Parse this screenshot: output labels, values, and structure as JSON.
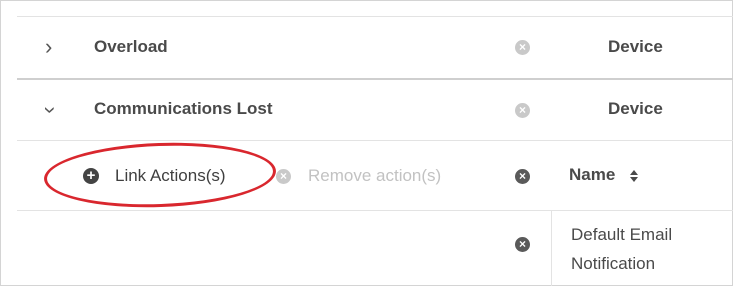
{
  "rows": [
    {
      "expand_icon": "chevron-right-icon",
      "label": "Overload",
      "type": "Device"
    },
    {
      "expand_icon": "chevron-down-icon",
      "label": "Communications Lost",
      "type": "Device"
    }
  ],
  "actions": {
    "link_label": "Link Actions(s)",
    "remove_label": "Remove action(s)",
    "highlight_color": "#d9272e"
  },
  "table": {
    "name_header": "Name",
    "items": [
      {
        "name_line1": "Default Email",
        "name_line2": "Notification"
      }
    ]
  },
  "icons": {
    "remove": "close-circle-icon",
    "add": "plus-circle-icon",
    "sort": "sort-icon"
  }
}
